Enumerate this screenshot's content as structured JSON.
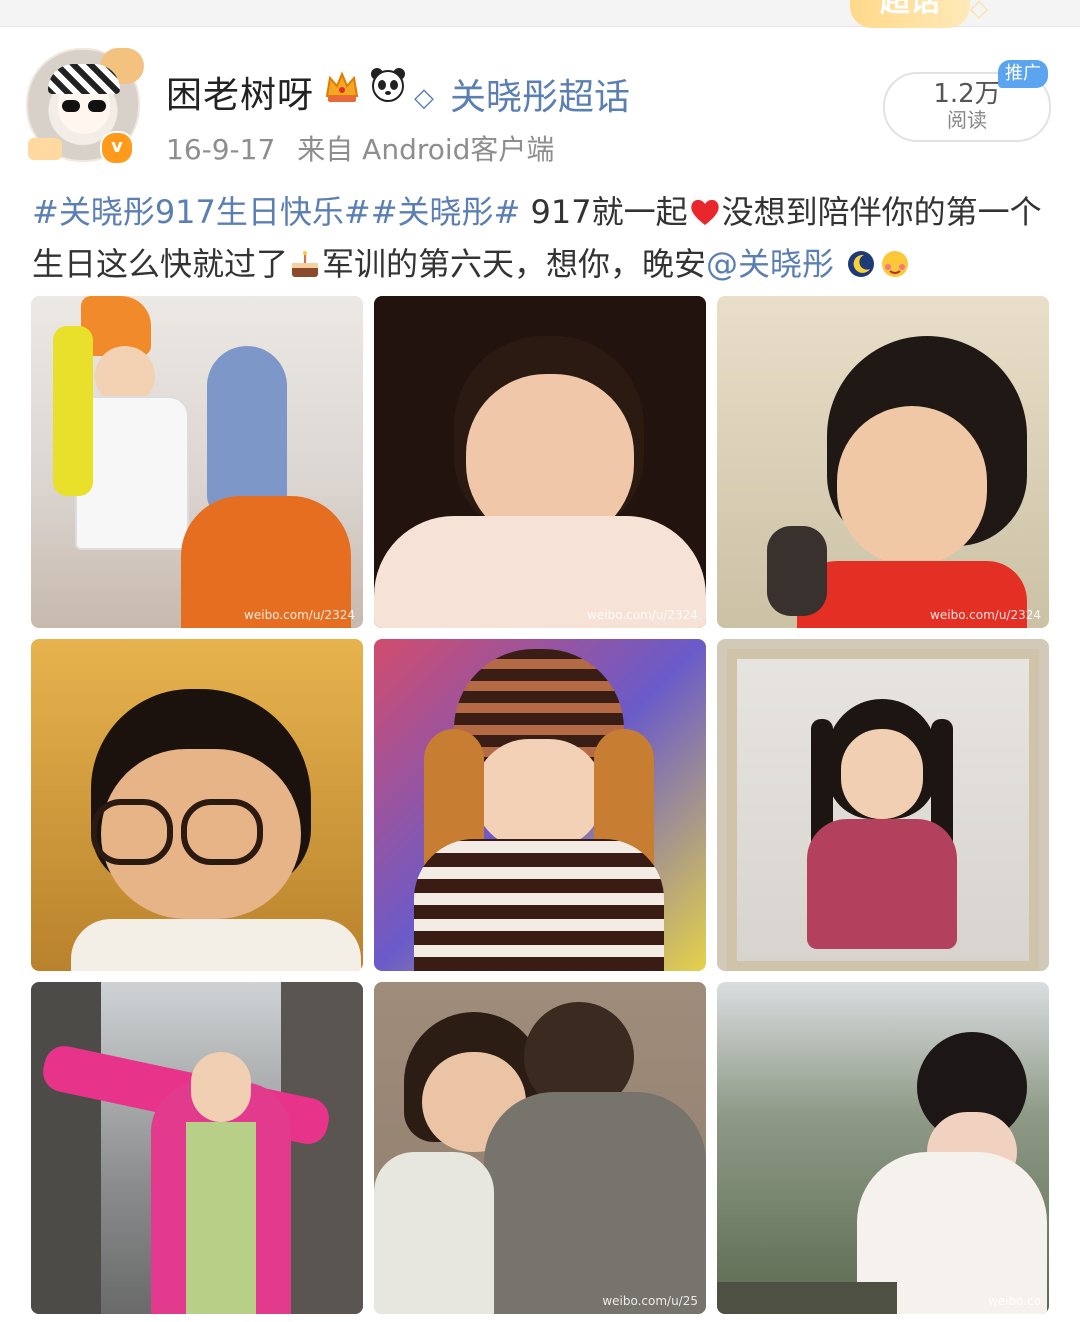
{
  "banner": {
    "chaohua_label": "超话"
  },
  "post": {
    "author": "困老树呀",
    "super_topic": "关晓彤超话",
    "date": "16-9-17",
    "source": "来自 Android客户端",
    "read_count": "1.2万",
    "read_label": "阅读",
    "ad_badge": "推广",
    "verified_glyph": "v",
    "text": {
      "tag1": "#关晓彤917生日快乐#",
      "tag2": "#关晓彤#",
      "t1": " 917就一起",
      "t2": "没想到陪伴你的第一个生日这么快就过了",
      "t3": "军训的第六天，想你，晚安",
      "mention": "@关晓彤"
    }
  },
  "photos": [
    {
      "name": "photo-toddler-with-dolls",
      "watermark": "weibo.com/u/2324"
    },
    {
      "name": "photo-baby-portrait",
      "watermark": "weibo.com/u/2324"
    },
    {
      "name": "photo-girl-red-collar",
      "watermark": "weibo.com/u/2324"
    },
    {
      "name": "photo-child-glasses",
      "watermark": ""
    },
    {
      "name": "photo-child-knit-hat",
      "watermark": ""
    },
    {
      "name": "photo-framed-pigtails",
      "watermark": ""
    },
    {
      "name": "photo-pink-coat-street",
      "watermark": ""
    },
    {
      "name": "photo-hugging-children",
      "watermark": "weibo.com/u/25"
    },
    {
      "name": "photo-woman-covering-face",
      "watermark": "weibo.co"
    }
  ],
  "colors": {
    "link": "#5b7fb3",
    "verified": "#ff9a1a",
    "ad": "#5ba5f0"
  }
}
